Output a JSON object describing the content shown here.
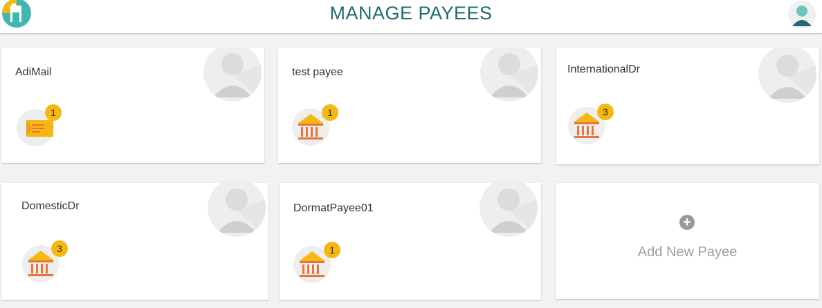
{
  "header": {
    "title": "MANAGE PAYEES",
    "logo_icon": "payee-app-logo-icon",
    "profile_icon": "user-avatar-icon"
  },
  "payees": [
    {
      "name": "AdiMail",
      "type_icon": "email-envelope-icon",
      "count": "1"
    },
    {
      "name": "test payee",
      "type_icon": "bank-icon",
      "count": "1"
    },
    {
      "name": "InternationalDr",
      "type_icon": "bank-icon",
      "count": "3"
    },
    {
      "name": "DomesticDr",
      "type_icon": "bank-icon",
      "count": "3"
    },
    {
      "name": "DormatPayee01",
      "type_icon": "bank-icon",
      "count": "1"
    }
  ],
  "add_payee": {
    "label": "Add New Payee",
    "icon": "plus-circle-icon"
  },
  "colors": {
    "title": "#1f6b6d",
    "badge": "#f5b812",
    "bank_roof": "#f5b812",
    "bank_columns": "#e8743b",
    "background": "#f2f2f2"
  }
}
